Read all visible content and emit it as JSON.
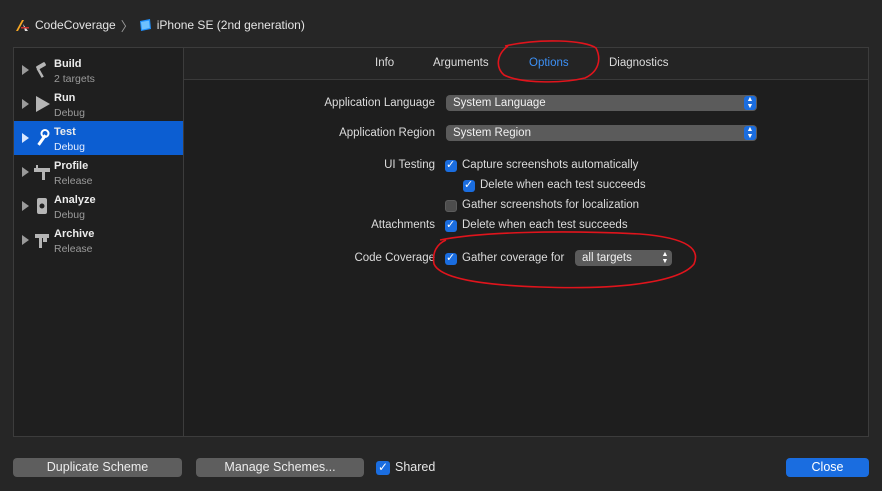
{
  "breadcrumb": {
    "project": "CodeCoverage",
    "device": "iPhone SE (2nd generation)"
  },
  "sidebar": {
    "items": [
      {
        "title": "Build",
        "sub": "2 targets",
        "icon": "hammer-icon"
      },
      {
        "title": "Run",
        "sub": "Debug",
        "icon": "play-icon"
      },
      {
        "title": "Test",
        "sub": "Debug",
        "icon": "wrench-icon",
        "selected": true
      },
      {
        "title": "Profile",
        "sub": "Release",
        "icon": "instruments-icon"
      },
      {
        "title": "Analyze",
        "sub": "Debug",
        "icon": "analyze-icon"
      },
      {
        "title": "Archive",
        "sub": "Release",
        "icon": "archive-icon"
      }
    ]
  },
  "tabs": [
    {
      "label": "Info"
    },
    {
      "label": "Arguments"
    },
    {
      "label": "Options",
      "active": true
    },
    {
      "label": "Diagnostics"
    }
  ],
  "options": {
    "app_language_label": "Application Language",
    "app_language_value": "System Language",
    "app_region_label": "Application Region",
    "app_region_value": "System Region",
    "ui_testing_label": "UI Testing",
    "capture_screenshots": "Capture screenshots automatically",
    "delete_when_succeeds": "Delete when each test succeeds",
    "gather_localization": "Gather screenshots for localization",
    "attachments_label": "Attachments",
    "attachments_delete": "Delete when each test succeeds",
    "code_coverage_label": "Code Coverage",
    "gather_coverage": "Gather coverage for",
    "coverage_targets": "all targets"
  },
  "footer": {
    "duplicate": "Duplicate Scheme",
    "manage": "Manage Schemes...",
    "shared": "Shared",
    "close": "Close"
  },
  "colors": {
    "accent": "#1a6de0",
    "selection": "#0c5ed2",
    "annotation": "#e0141c"
  }
}
